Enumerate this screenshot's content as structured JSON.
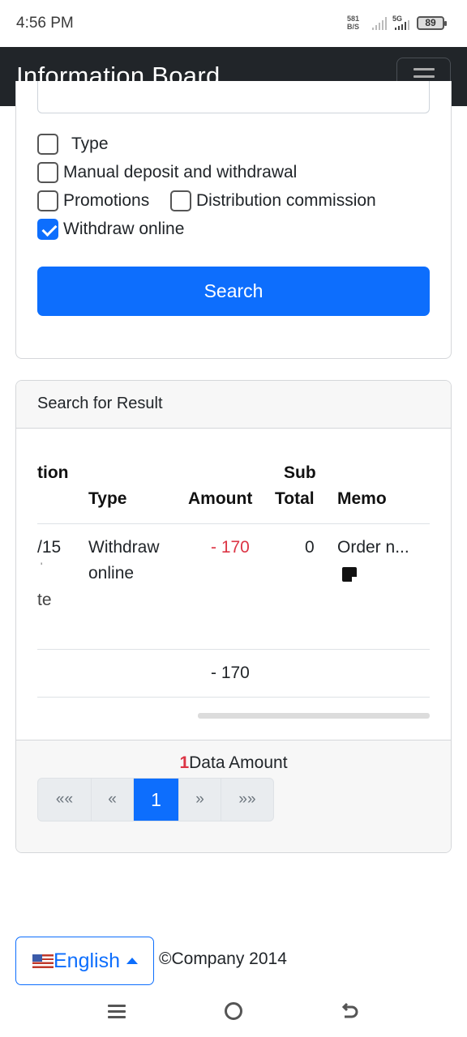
{
  "status_bar": {
    "time": "4:56 PM",
    "net_speed_value": "581",
    "net_speed_unit": "B/S",
    "network_type": "5G",
    "battery": "89"
  },
  "navbar": {
    "brand": "Information Board",
    "menu_icon": "hamburger-icon"
  },
  "filters": {
    "type_label": "Type",
    "options": [
      {
        "label": "Manual deposit and withdrawal",
        "checked": false
      },
      {
        "label": "Promotions",
        "checked": false
      },
      {
        "label": "Distribution commission",
        "checked": false
      },
      {
        "label": "Withdraw online",
        "checked": true
      }
    ],
    "type_checked": false,
    "search_label": "Search"
  },
  "results": {
    "header": "Search for Result",
    "columns": {
      "col1": "tion",
      "type": "Type",
      "amount": "Amount",
      "subtotal_line1": "Sub",
      "subtotal_line2": "Total",
      "memo": "Memo"
    },
    "rows": [
      {
        "col1_line1": "/15",
        "col1_line2": "'",
        "col1_line3": "te",
        "type_line1": "Withdraw",
        "type_line2": "online",
        "amount": "- 170",
        "subtotal": "0",
        "memo": "Order n...",
        "memo_icon": "note-icon"
      }
    ],
    "total_amount": "- 170",
    "data_amount_count": "1",
    "data_amount_label": "Data Amount",
    "pagination": [
      "««",
      "«",
      "1",
      "»",
      "»»"
    ],
    "active_page": "1"
  },
  "footer": {
    "language": "English",
    "flag_icon": "us-flag-icon",
    "copyright": "©Company 2014"
  },
  "colors": {
    "primary": "#0d6efd",
    "navbar": "#212529",
    "negative": "#dc3545"
  }
}
